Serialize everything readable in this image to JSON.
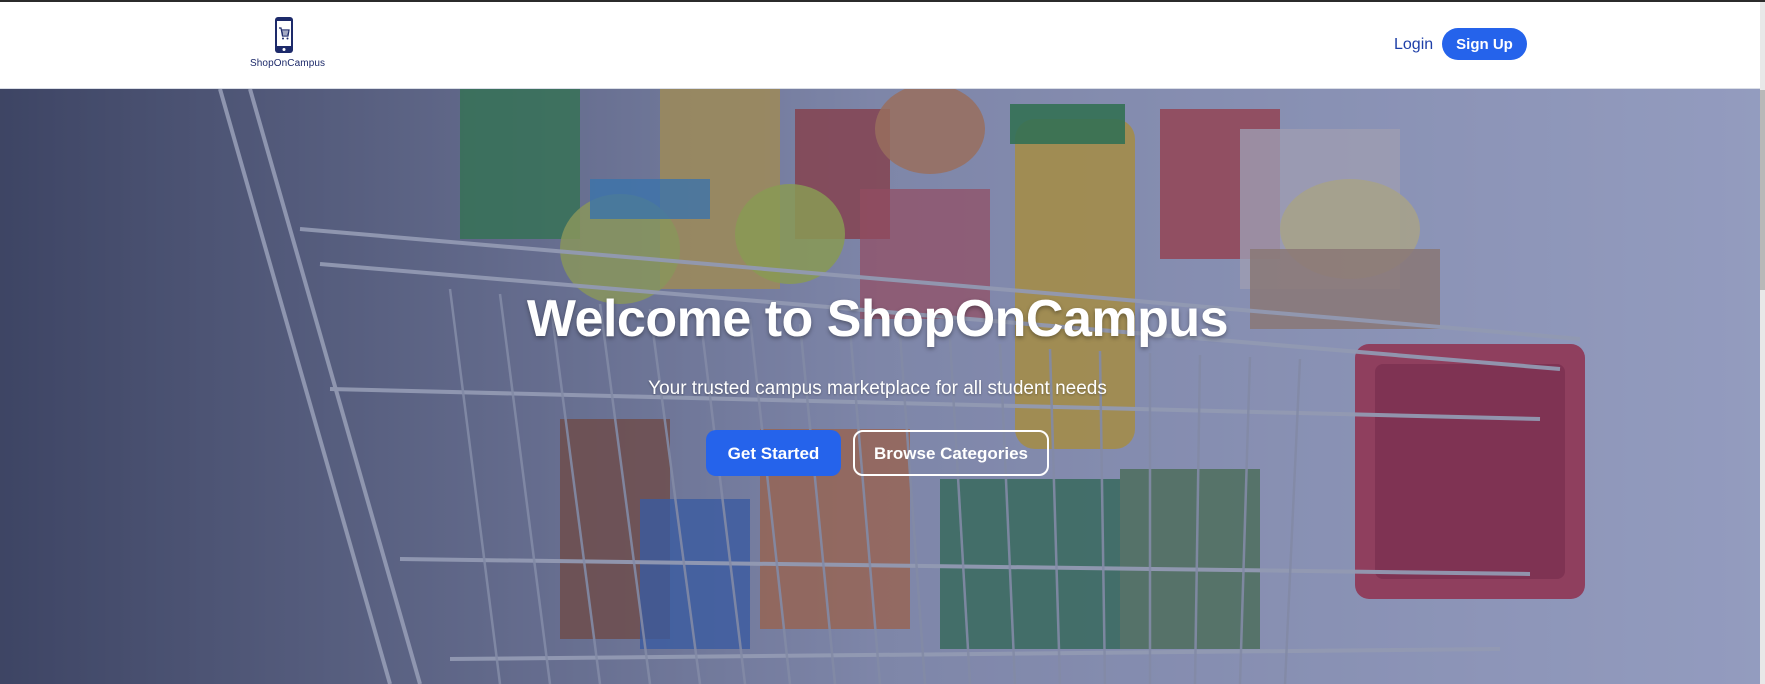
{
  "header": {
    "logo_text": "ShopOnCampus",
    "login_label": "Login",
    "signup_label": "Sign Up"
  },
  "hero": {
    "title": "Welcome to ShopOnCampus",
    "subtitle": "Your trusted campus marketplace for all student needs",
    "primary_button": "Get Started",
    "secondary_button": "Browse Categories"
  },
  "icons": {
    "logo": "phone-cart-icon"
  },
  "colors": {
    "accent": "#2563eb",
    "logo": "#1d2a6a",
    "nav_link": "#1e3fa8"
  }
}
